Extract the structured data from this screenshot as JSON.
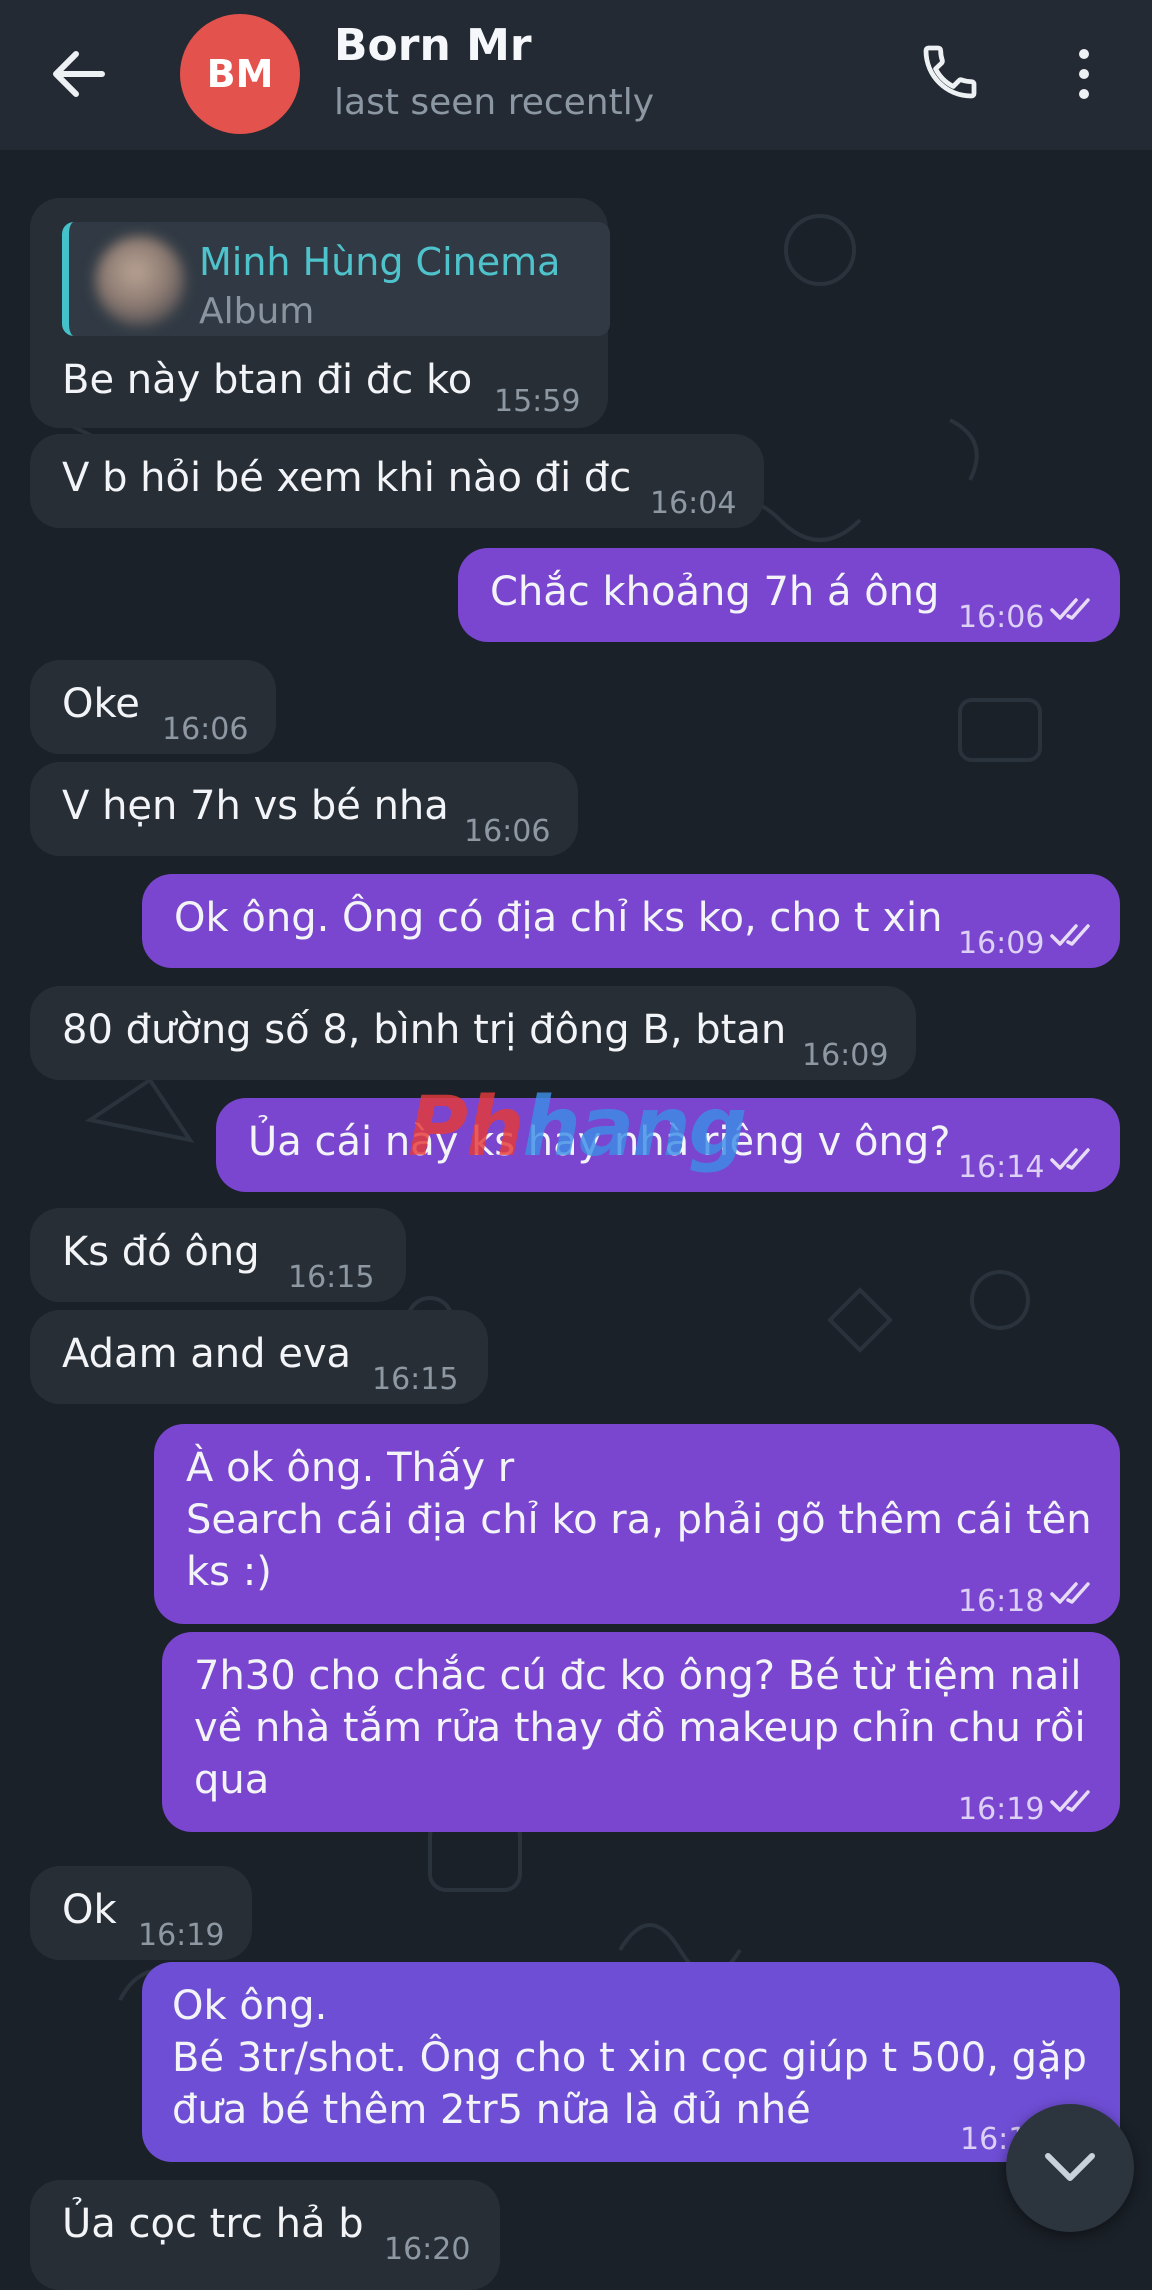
{
  "header": {
    "contact_name": "Born Mr",
    "status": "last seen recently",
    "avatar_initials": "BM",
    "avatar_color": "#e3524d"
  },
  "reply_preview": {
    "sender": "Minh Hùng Cinema",
    "subtitle": "Album"
  },
  "messages": [
    {
      "direction": "in",
      "text": "Be này btan đi đc ko",
      "time": "15:59"
    },
    {
      "direction": "in",
      "text": "V b hỏi bé xem khi nào đi đc",
      "time": "16:04"
    },
    {
      "direction": "out",
      "text": "Chắc khoảng 7h á ông",
      "time": "16:06",
      "read": true
    },
    {
      "direction": "in",
      "text": "Oke",
      "time": "16:06"
    },
    {
      "direction": "in",
      "text": "V hẹn 7h vs bé nha",
      "time": "16:06"
    },
    {
      "direction": "out",
      "text": "Ok ông. Ông có địa chỉ ks ko, cho t xin",
      "time": "16:09",
      "read": true
    },
    {
      "direction": "in",
      "text": "80 đường số 8, bình trị đông B, btan",
      "time": "16:09"
    },
    {
      "direction": "out",
      "text": "Ủa cái này ks hay nhà riêng v ông?",
      "time": "16:14",
      "read": true
    },
    {
      "direction": "in",
      "text": "Ks đó ông",
      "time": "16:15"
    },
    {
      "direction": "in",
      "text": "Adam and eva",
      "time": "16:15"
    },
    {
      "direction": "out",
      "lines": [
        "À ok ông. Thấy r",
        "Search cái địa chỉ ko ra, phải gõ thêm cái tên",
        "ks :)"
      ],
      "time": "16:18",
      "read": true
    },
    {
      "direction": "out",
      "lines": [
        "7h30 cho chắc cú đc ko ông? Bé từ tiệm nail",
        "về nhà tắm rửa thay đồ makeup chỉn chu rồi",
        "qua"
      ],
      "time": "16:19",
      "read": true
    },
    {
      "direction": "in",
      "text": "Ok",
      "time": "16:19"
    },
    {
      "direction": "out",
      "lines": [
        "Ok ông.",
        "Bé 3tr/shot. Ông cho t xin cọc giúp t 500, gặp",
        "đưa bé thêm 2tr5 nữa là đủ nhé"
      ],
      "time": "16:1",
      "read": true
    },
    {
      "direction": "in",
      "text": "Ủa cọc trc hả b",
      "time": "16:20"
    }
  ],
  "watermark": {
    "part1": "Ph",
    "part2": "hang"
  },
  "colors": {
    "background": "#1b2129",
    "incoming_bubble": "#272e36",
    "outgoing_bubble": "#7a45cf",
    "header": "#232a33",
    "reply_accent": "#45c1c9"
  },
  "icons": {
    "back": "arrow-left-icon",
    "call": "phone-icon",
    "menu": "more-vertical-icon",
    "read_receipt": "double-check-icon",
    "scroll": "chevron-down-icon"
  }
}
